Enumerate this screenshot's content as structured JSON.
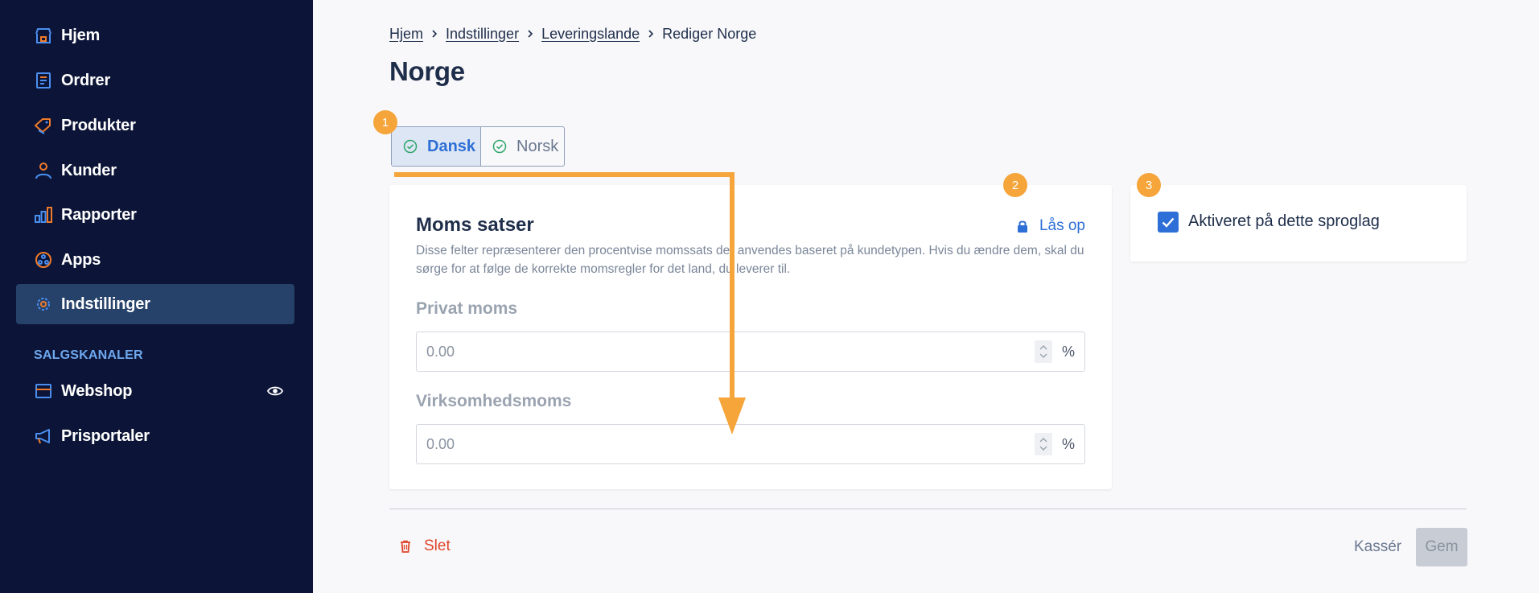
{
  "sidebar": {
    "items": [
      {
        "label": "Hjem",
        "icon": "shop-icon"
      },
      {
        "label": "Ordrer",
        "icon": "receipt-icon"
      },
      {
        "label": "Produkter",
        "icon": "tag-icon"
      },
      {
        "label": "Kunder",
        "icon": "person-icon"
      },
      {
        "label": "Rapporter",
        "icon": "bar-chart-icon"
      },
      {
        "label": "Apps",
        "icon": "apps-icon"
      },
      {
        "label": "Indstillinger",
        "icon": "gear-icon",
        "active": true
      }
    ],
    "section_title": "SALGSKANALER",
    "channels": [
      {
        "label": "Webshop",
        "icon": "store-icon",
        "extra_icon": "eye-icon"
      },
      {
        "label": "Prisportaler",
        "icon": "megaphone-icon"
      }
    ]
  },
  "breadcrumb": {
    "items": [
      "Hjem",
      "Indstillinger",
      "Leveringslande"
    ],
    "current": "Rediger Norge"
  },
  "page": {
    "title": "Norge"
  },
  "language_tabs": [
    {
      "label": "Dansk",
      "active": true
    },
    {
      "label": "Norsk",
      "active": false
    }
  ],
  "moms_card": {
    "title": "Moms satser",
    "unlock_label": "Lås op",
    "description": "Disse felter repræsenterer den procentvise momssats der anvendes baseret på kundetypen. Hvis du ændre dem, skal du sørge for at følge de korrekte momsregler for det land, du leverer til.",
    "fields": [
      {
        "label": "Privat moms",
        "value": "0.00",
        "unit": "%"
      },
      {
        "label": "Virksomhedsmoms",
        "value": "0.00",
        "unit": "%"
      }
    ]
  },
  "activate_card": {
    "label": "Aktiveret på dette sproglag",
    "checked": true
  },
  "footer": {
    "delete_label": "Slet",
    "discard_label": "Kassér",
    "save_label": "Gem"
  },
  "badges": [
    "1",
    "2",
    "3"
  ],
  "colors": {
    "sidebar_bg": "#0c1537",
    "active_item_bg": "#26426a",
    "icon_blue": "#4a8ff0",
    "icon_orange": "#f07b2a",
    "accent_blue": "#2d6fd6",
    "annotation_orange": "#f5a53a",
    "danger": "#e0452a"
  }
}
